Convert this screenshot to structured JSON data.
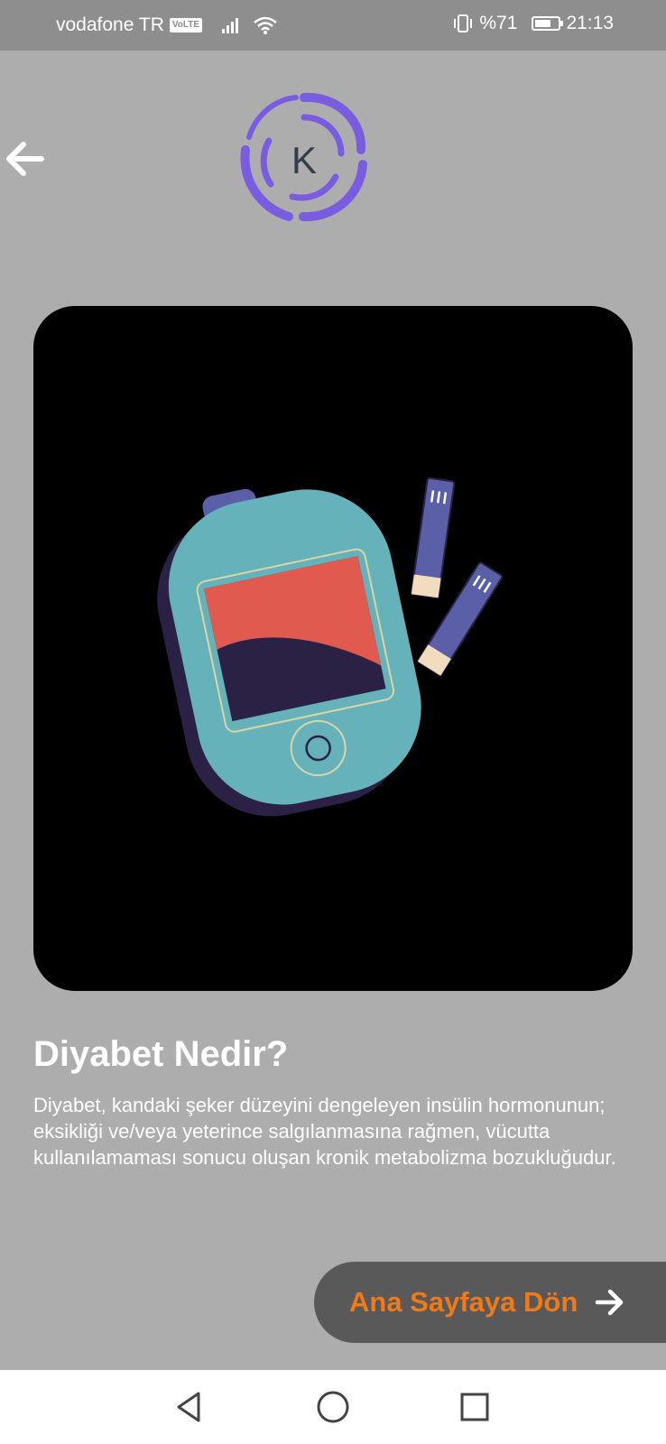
{
  "status_bar": {
    "carrier": "vodafone TR",
    "volte": "VoLTE",
    "battery_percent": "%71",
    "battery_level": 0.71,
    "time": "21:13"
  },
  "header": {
    "back_icon": "arrow-left-icon",
    "logo_letter": "K",
    "logo_color": "#7a5ce0"
  },
  "hero": {
    "image_icon": "glucose-meter-illustration",
    "background": "#000000"
  },
  "content": {
    "title": "Diyabet Nedir?",
    "description": "Diyabet, kandaki şeker düzeyini dengeleyen insülin hormonunun; eksikliği ve/veya yeterince salgılanmasına rağmen, vücutta kullanılamaması sonucu oluşan kronik metabolizma bozukluğudur."
  },
  "home_button": {
    "label": "Ana Sayfaya Dön",
    "icon": "arrow-right-icon",
    "label_color": "#f07a19"
  },
  "nav_bar": {
    "back_icon": "triangle-back-icon",
    "home_icon": "circle-home-icon",
    "recents_icon": "square-recents-icon"
  }
}
